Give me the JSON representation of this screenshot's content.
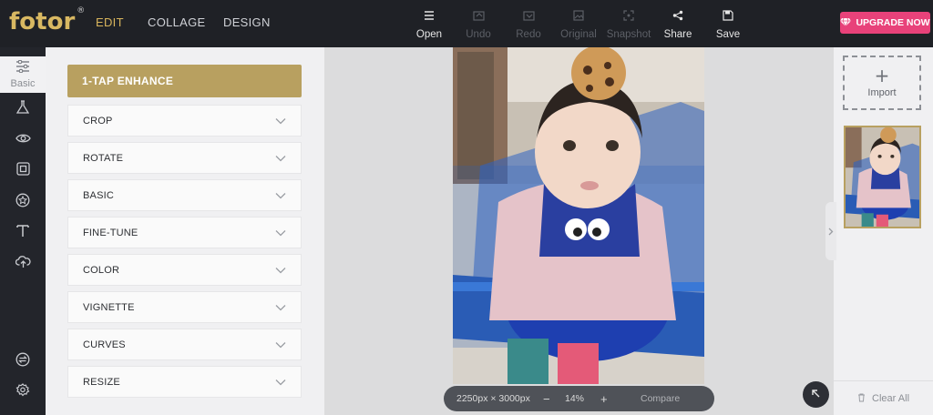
{
  "app": {
    "logo_text": "fotor",
    "logo_mark": "®",
    "brand_color": "#d8b862"
  },
  "nav": {
    "tabs": [
      "EDIT",
      "COLLAGE",
      "DESIGN"
    ],
    "active_tab": "EDIT"
  },
  "toolbar": {
    "items": [
      {
        "label": "Open",
        "icon": "menu-icon",
        "enabled": true
      },
      {
        "label": "Undo",
        "icon": "undo-icon",
        "enabled": false
      },
      {
        "label": "Redo",
        "icon": "redo-icon",
        "enabled": false
      },
      {
        "label": "Original",
        "icon": "image-icon",
        "enabled": false
      },
      {
        "label": "Snapshot",
        "icon": "snapshot-icon",
        "enabled": false
      },
      {
        "label": "Share",
        "icon": "share-icon",
        "enabled": true
      },
      {
        "label": "Save",
        "icon": "save-icon",
        "enabled": true
      }
    ],
    "upgrade_label": "UPGRADE NOW",
    "upgrade_color": "#e8427a"
  },
  "rail": {
    "items": [
      {
        "label": "Basic",
        "icon": "sliders-icon",
        "active": true
      },
      {
        "label": "",
        "icon": "flask-icon",
        "active": false
      },
      {
        "label": "",
        "icon": "eye-icon",
        "active": false
      },
      {
        "label": "",
        "icon": "frame-icon",
        "active": false
      },
      {
        "label": "",
        "icon": "star-badge-icon",
        "active": false
      },
      {
        "label": "",
        "icon": "text-icon",
        "active": false
      },
      {
        "label": "",
        "icon": "cloud-upload-icon",
        "active": false
      },
      {
        "label": "",
        "icon": "compare-icon",
        "active": false
      },
      {
        "label": "",
        "icon": "settings-icon",
        "active": false
      }
    ]
  },
  "panel": {
    "enhance_label": "1-TAP ENHANCE",
    "enhance_color": "#b8a060",
    "items": [
      "CROP",
      "ROTATE",
      "BASIC",
      "FINE-TUNE",
      "COLOR",
      "VIGNETTE",
      "CURVES",
      "RESIZE"
    ]
  },
  "canvas": {
    "dimensions": "2250px × 3000px",
    "minus": "−",
    "zoom": "14%",
    "plus": "+",
    "compare_label": "Compare"
  },
  "right_panel": {
    "import_label": "Import",
    "clear_label": "Clear All"
  }
}
